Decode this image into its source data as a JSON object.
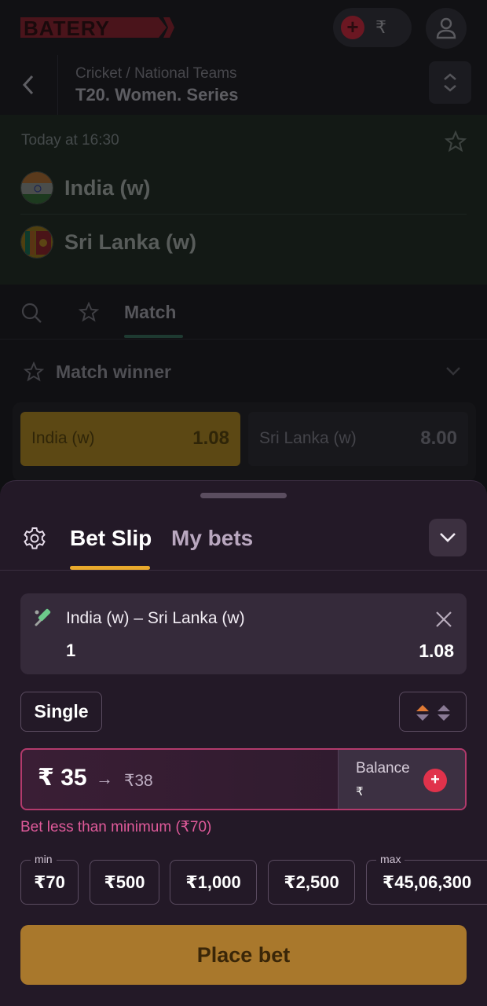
{
  "app": {
    "logo_text": "BATERY",
    "brand_color": "#e0324b",
    "accent_color": "#e9a92c"
  },
  "header": {
    "balance_currency": "₹"
  },
  "breadcrumb": {
    "category": "Cricket / National Teams",
    "title": "T20. Women. Series"
  },
  "event": {
    "time": "Today at 16:30",
    "team1": "India (w)",
    "team2": "Sri Lanka (w)"
  },
  "market_tabs": {
    "match_label": "Match"
  },
  "market": {
    "title": "Match winner",
    "outcomes": [
      {
        "label": "India (w)",
        "odds": "1.08",
        "selected": true
      },
      {
        "label": "Sri Lanka (w)",
        "odds": "8.00",
        "selected": false
      }
    ]
  },
  "bet_slip": {
    "tabs": [
      "Bet Slip",
      "My bets"
    ],
    "active_tab": "Bet Slip",
    "selection": {
      "event": "India (w) – Sri Lanka (w)",
      "outcome": "1",
      "odds": "1.08"
    },
    "bet_type": "Single",
    "stake": {
      "amount": "₹ 35",
      "arrow": "→",
      "potential_win": "₹38"
    },
    "balance": {
      "label": "Balance",
      "currency": "₹"
    },
    "error": "Bet less than minimum (₹70)",
    "quick_stakes": [
      {
        "caption": "min",
        "value": "₹70"
      },
      {
        "caption": "",
        "value": "₹500"
      },
      {
        "caption": "",
        "value": "₹1,000"
      },
      {
        "caption": "",
        "value": "₹2,500"
      },
      {
        "caption": "max",
        "value": "₹45,06,300"
      }
    ],
    "place_bet_label": "Place bet"
  }
}
